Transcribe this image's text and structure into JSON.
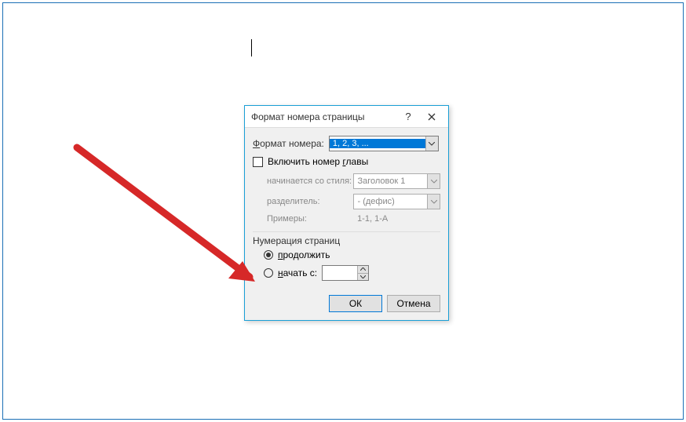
{
  "dialog": {
    "title": "Формат номера страницы",
    "help": "?",
    "format_label": "Формат номера:",
    "format_value": "1, 2, 3, ...",
    "include_chapter": "Включить номер главы",
    "starts_with_style_label": "начинается со стиля:",
    "starts_with_style_value": "Заголовок 1",
    "separator_label": "разделитель:",
    "separator_value": "-    (дефис)",
    "examples_label": "Примеры:",
    "examples_value": "1-1, 1-A",
    "numbering_group": "Нумерация страниц",
    "continue_label": "продолжить",
    "start_at_label": "начать с:",
    "start_at_value": "",
    "ok": "ОК",
    "cancel": "Отмена"
  }
}
